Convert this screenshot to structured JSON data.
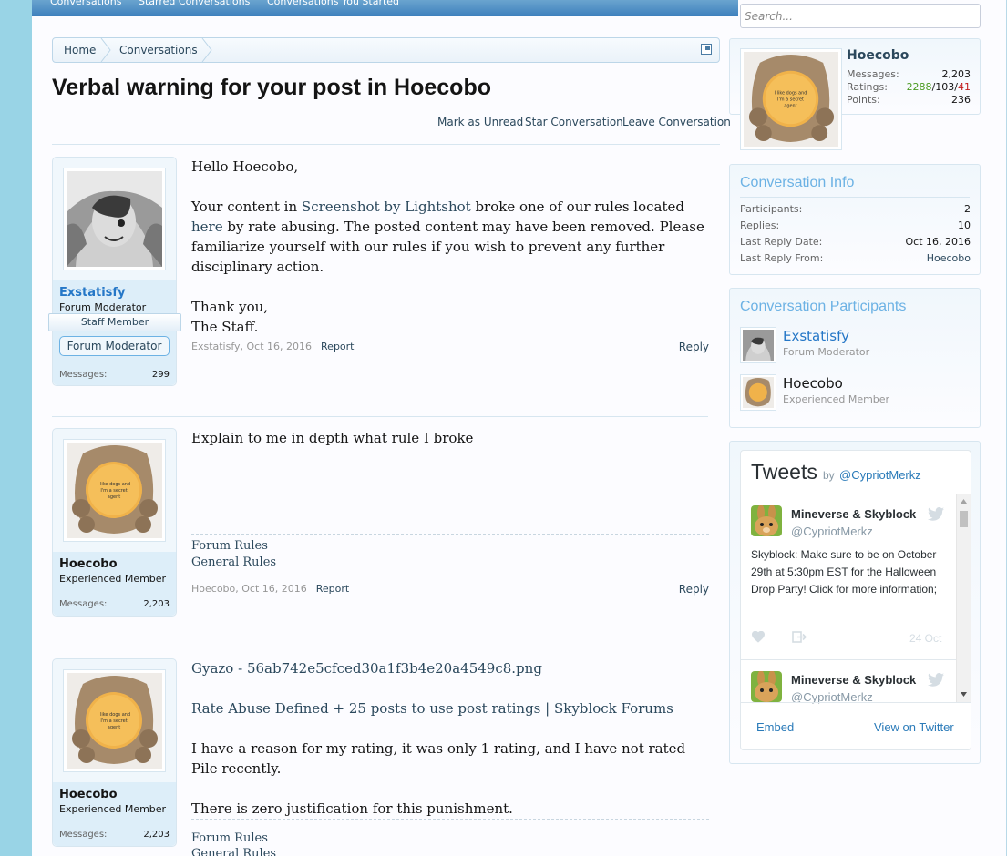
{
  "nav": {
    "tabs": [
      "Conversations",
      "Starred Conversations",
      "Conversations You Started"
    ]
  },
  "search": {
    "placeholder": "Search..."
  },
  "breadcrumb": {
    "home": "Home",
    "conversations": "Conversations"
  },
  "page_title": "Verbal warning for your post in Hoecobo",
  "actions": {
    "mark_unread": "Mark as Unread",
    "star": "Star Conversation",
    "leave": "Leave Conversation"
  },
  "messages": [
    {
      "username": "Exstatisfy",
      "user_title": "Forum Moderator",
      "staff_badge": "Staff Member",
      "banner": "Forum Moderator",
      "messages_label": "Messages:",
      "messages_count": "299",
      "greeting": "Hello Hoecobo,",
      "p1_a": "Your content in ",
      "p1_link1": "Screenshot by Lightshot",
      "p1_b": " broke one of our rules located ",
      "p1_link2": "here",
      "p1_c": " by rate abusing. The posted content may have been removed. Please familiarize yourself with our rules if you wish to prevent any further disciplinary action.",
      "thanks": "Thank you,",
      "staff": "The Staff.",
      "meta": "Exstatisfy, Oct 16, 2016",
      "report": "Report",
      "reply": "Reply"
    },
    {
      "username": "Hoecobo",
      "user_title": "Experienced Member",
      "messages_label": "Messages:",
      "messages_count": "2,203",
      "body": "Explain to me in depth what rule I broke",
      "sig1": "Forum Rules",
      "sig2": "General Rules",
      "meta": "Hoecobo, Oct 16, 2016",
      "report": "Report",
      "reply": "Reply"
    },
    {
      "username": "Hoecobo",
      "user_title": "Experienced Member",
      "messages_label": "Messages:",
      "messages_count": "2,203",
      "link1": "Gyazo - 56ab742e5cfced30a1f3b4e20a4549c8.png",
      "link2": "Rate Abuse Defined + 25 posts to use post ratings | Skyblock Forums",
      "p1": "I have a reason for my rating, it was only 1 rating, and I have not rated Pile recently.",
      "p2": "There is zero justification for this punishment.",
      "sig1": "Forum Rules",
      "sig2": "General Rules"
    }
  ],
  "avatar_text": "I like dogs and I'm a secret agent",
  "visitor": {
    "name": "Hoecobo",
    "messages_label": "Messages:",
    "messages": "2,203",
    "ratings_label": "Ratings:",
    "ratings_pos": "2288",
    "ratings_sep1": "/",
    "ratings_neu": "103",
    "ratings_sep2": "/",
    "ratings_neg": "41",
    "points_label": "Points:",
    "points": "236"
  },
  "conv_info": {
    "title": "Conversation Info",
    "rows": [
      {
        "label": "Participants:",
        "value": "2"
      },
      {
        "label": "Replies:",
        "value": "10"
      },
      {
        "label": "Last Reply Date:",
        "value": "Oct 16, 2016"
      },
      {
        "label": "Last Reply From:",
        "value": "Hoecobo"
      }
    ]
  },
  "participants": {
    "title": "Conversation Participants",
    "list": [
      {
        "name": "Exstatisfy",
        "title": "Forum Moderator"
      },
      {
        "name": "Hoecobo",
        "title": "Experienced Member"
      }
    ]
  },
  "tweets": {
    "title": "Tweets",
    "by": "by",
    "handle": "@CypriotMerkz",
    "items": [
      {
        "author": "Mineverse & Skyblock",
        "handle": "@CypriotMerkz",
        "text": "Skyblock: Make sure to be on October 29th at 5:30pm EST for the Halloween Drop Party! Click for more information;",
        "date": "24 Oct"
      },
      {
        "author": "Mineverse & Skyblock",
        "handle": "@CypriotMerkz"
      }
    ],
    "embed": "Embed",
    "view": "View on Twitter"
  },
  "colors": {
    "link": "#2b485c",
    "sidebar_heading": "#6cb2e4",
    "username_staff": "#2577c7",
    "ratings_positive": "#4b9b22",
    "ratings_negative": "#c21a1a",
    "background": "#99d4e6"
  }
}
